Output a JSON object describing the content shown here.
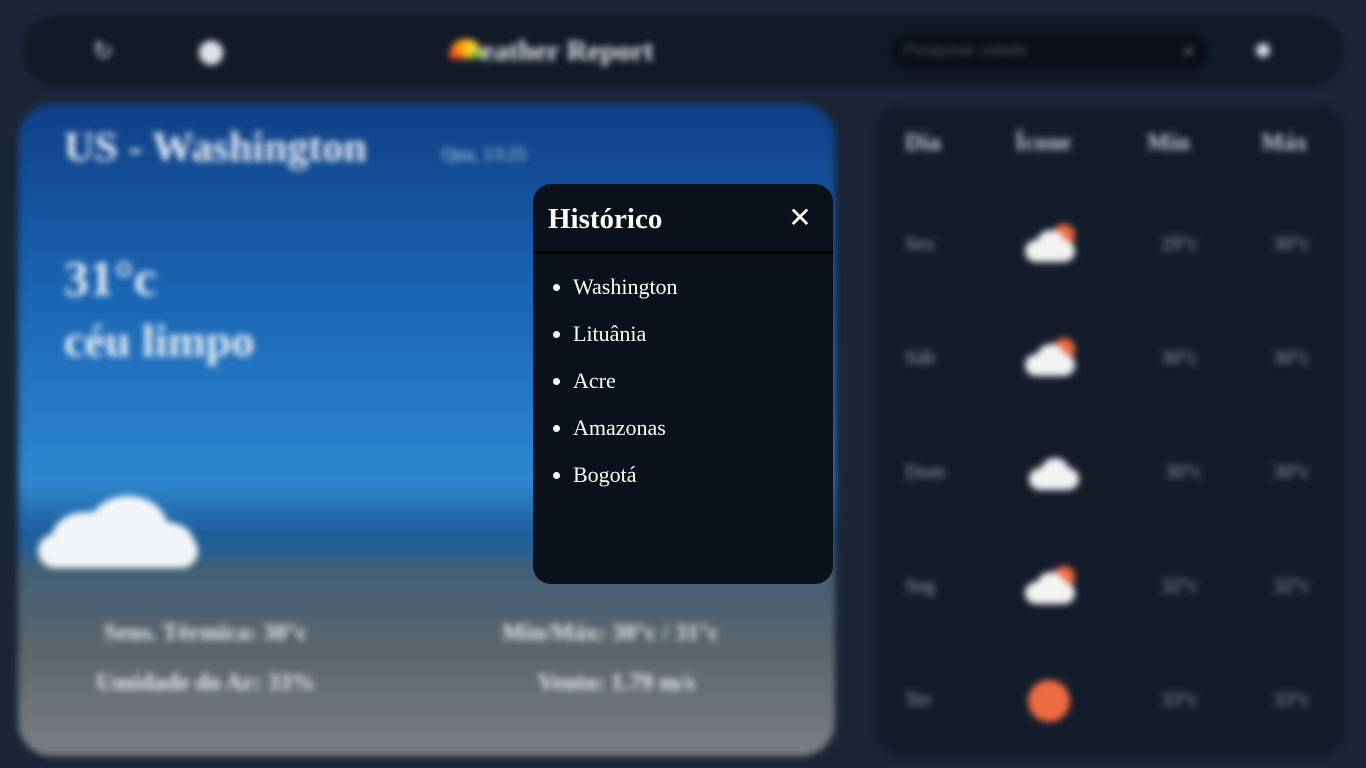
{
  "app": {
    "title": "Weather Report"
  },
  "header": {
    "logo_icon": "rainbow-icon",
    "title_rest": "eather Report",
    "search_placeholder": "Pesquisar cidade",
    "icons": [
      "theme-toggle-icon",
      "location-pin-icon",
      "search-icon",
      "settings-icon"
    ]
  },
  "current": {
    "city": "US - Washington",
    "datetime": "Qua, 13:25",
    "temperature": "31°c",
    "condition": "céu limpo",
    "feels_like": "Sens. Térmica: 30°c",
    "min_max": "Min/Máx: 30°c / 31°c",
    "humidity": "Umidade do Ar: 33%",
    "wind": "Vento: 1.79 m/s"
  },
  "forecast": {
    "headers": [
      "Dia",
      "Ícone",
      "Mín",
      "Máx"
    ],
    "rows": [
      {
        "day": "Sex",
        "icon": "partly-cloudy-icon",
        "min": "29°c",
        "max": "30°c"
      },
      {
        "day": "Sáb",
        "icon": "partly-cloudy-icon",
        "min": "30°c",
        "max": "30°c"
      },
      {
        "day": "Dom",
        "icon": "cloudy-icon",
        "min": "30°c",
        "max": "30°c"
      },
      {
        "day": "Seg",
        "icon": "partly-cloudy-icon",
        "min": "32°c",
        "max": "32°c"
      },
      {
        "day": "Ter",
        "icon": "sunny-icon",
        "min": "33°c",
        "max": "33°c"
      }
    ]
  },
  "history_modal": {
    "title": "Histórico",
    "close_symbol": "✕",
    "items": [
      "Washington",
      "Lituânia",
      "Acre",
      "Amazonas",
      "Bogotá"
    ]
  },
  "colors": {
    "background": "#1b2536",
    "modal_background": "#0b111b",
    "accent_sun": "#ee6a40"
  }
}
